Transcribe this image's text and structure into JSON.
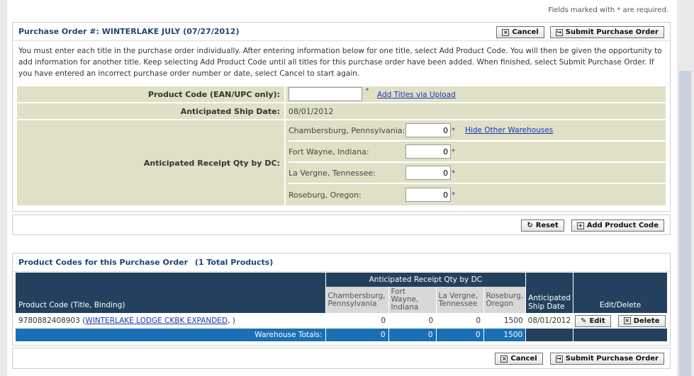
{
  "required_note": "Fields marked with * are required.",
  "po": {
    "title": "Purchase Order #: WINTERLAKE JULY (07/27/2012)",
    "cancel_label": "Cancel",
    "submit_label": "Submit Purchase Order",
    "instructions": "You must enter each title in the purchase order individually. After entering information below for one title, select Add Product Code. You will then be given the opportunity to add information for another title. Keep selecting Add Product Code until all titles for this purchase order have been added. When finished, select Submit Purchase Order. If you have entered an incorrect purchase order number or date, select Cancel to start again."
  },
  "form": {
    "product_code_label": "Product Code (EAN/UPC only):",
    "product_code_value": "",
    "required_star": "*",
    "add_titles_link": "Add Titles via Upload",
    "ship_date_label": "Anticipated Ship Date:",
    "ship_date_value": "08/01/2012",
    "receipt_qty_label": "Anticipated Receipt Qty by DC:",
    "hide_warehouses_link": "Hide Other Warehouses",
    "dcs": [
      {
        "name": "Chambersburg, Pennsylvania:",
        "qty": "0"
      },
      {
        "name": "Fort Wayne, Indiana:",
        "qty": "0"
      },
      {
        "name": "La Vergne, Tennessee:",
        "qty": "0"
      },
      {
        "name": "Roseburg, Oregon:",
        "qty": "0"
      }
    ]
  },
  "actions": {
    "reset_label": "Reset",
    "add_product_label": "Add Product Code"
  },
  "products": {
    "title": "Product Codes for this Purchase Order",
    "total_label": "(1 Total Products)",
    "group_header": "Anticipated Receipt Qty by DC",
    "col_product": "Product Code (Title, Binding)",
    "col_dc": [
      "Chambersburg, Pennsylvania",
      "Fort Wayne, Indiana",
      "La Vergne, Tennessee",
      "Roseburg, Oregon"
    ],
    "col_ship": "Anticipated Ship Date",
    "col_edit": "Edit/Delete",
    "rows": [
      {
        "code": "9780882408903",
        "open_paren": "(",
        "title_link": "WINTERLAKE LODGE CKBK EXPANDED",
        "close": ", )",
        "qty": [
          "0",
          "0",
          "0",
          "1500"
        ],
        "ship_date": "08/01/2012",
        "edit_label": "Edit",
        "delete_label": "Delete"
      }
    ],
    "totals_label": "Warehouse Totals:",
    "totals": [
      "0",
      "0",
      "0",
      "1500"
    ]
  },
  "bottom": {
    "cancel_label": "Cancel",
    "submit_label": "Submit Purchase Order"
  },
  "colors": {
    "header_dark": "#23415e",
    "totals_blue": "#1b6fb4",
    "form_bg": "#e0e0c6",
    "title_blue": "#1e4678",
    "link_blue": "#1a37b8"
  }
}
